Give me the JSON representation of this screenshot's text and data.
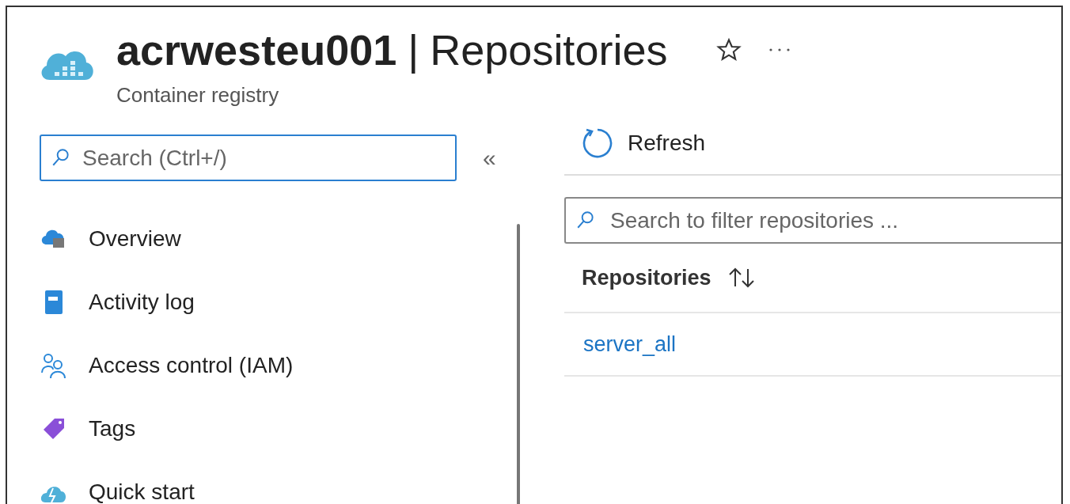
{
  "header": {
    "resource_name": "acrwesteu001",
    "separator": "|",
    "page_title": "Repositories",
    "subtitle": "Container registry"
  },
  "sidebar": {
    "search": {
      "placeholder": "Search (Ctrl+/)",
      "focused": true
    },
    "collapse": "«",
    "items": [
      {
        "label": "Overview"
      },
      {
        "label": "Activity log"
      },
      {
        "label": "Access control (IAM)"
      },
      {
        "label": "Tags"
      },
      {
        "label": "Quick start"
      }
    ]
  },
  "toolbar": {
    "refresh": "Refresh"
  },
  "filter": {
    "placeholder": "Search to filter repositories ..."
  },
  "table": {
    "columns": [
      "Repositories"
    ],
    "rows": [
      {
        "name": "server_all"
      }
    ]
  }
}
